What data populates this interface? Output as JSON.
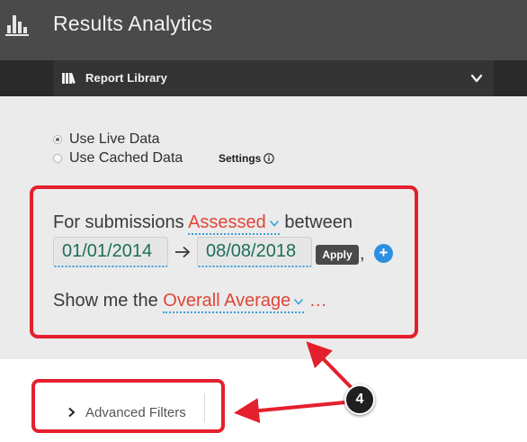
{
  "header": {
    "title": "Results Analytics",
    "icon": "bar-chart-icon"
  },
  "library": {
    "label": "Report Library",
    "icon": "library-books-icon",
    "toggle_icon": "chevron-down-icon"
  },
  "data_source": {
    "options": [
      {
        "label": "Use Live Data",
        "selected": true
      },
      {
        "label": "Use Cached Data",
        "selected": false
      }
    ],
    "settings_label": "Settings",
    "settings_icon": "info-icon"
  },
  "query": {
    "prefix": "For submissions",
    "status_value": "Assessed",
    "between_label": "between",
    "start_date": "01/01/2014",
    "end_date": "08/08/2018",
    "apply_label": "Apply",
    "comma": ",",
    "add_label": "+",
    "show_prefix": "Show me the",
    "metric_value": "Overall Average",
    "ellipsis": "…"
  },
  "advanced": {
    "label": "Advanced Filters"
  },
  "annotation": {
    "step_number": "4"
  },
  "colors": {
    "header_bg": "#4a4a4a",
    "library_bar_bg": "#343434",
    "panel_bg": "#ebebeb",
    "dropdown_text": "#e0463a",
    "date_text": "#1d6e59",
    "highlight_red": "#e4202e",
    "plus_button": "#2d8fe0"
  }
}
